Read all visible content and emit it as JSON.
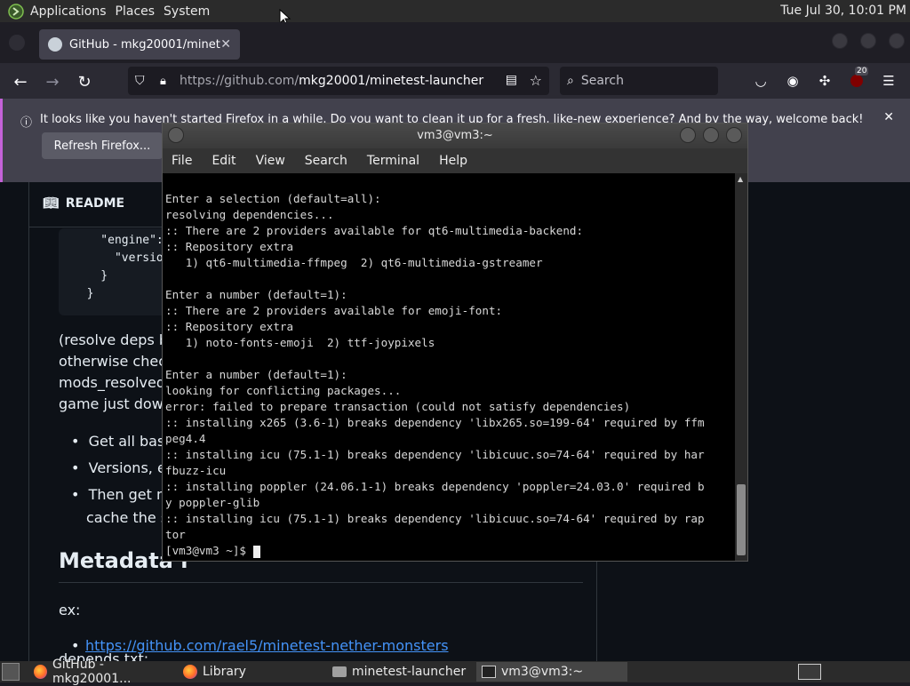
{
  "top_panel": {
    "menus": [
      "Applications",
      "Places",
      "System"
    ],
    "clock": "Tue Jul 30, 10:01 PM"
  },
  "firefox": {
    "tab_title": "GitHub - mkg20001/minete",
    "url_prefix": "https://github.com/",
    "url_path": "mkg20001/minetest-launcher",
    "search_placeholder": "Search",
    "badge_count": "20",
    "notification_text": "It looks like you haven't started Firefox in a while. Do you want to clean it up for a fresh, like-new experience? And by the way, welcome back!",
    "notification_button": "Refresh Firefox..."
  },
  "github": {
    "readme_label": "README",
    "code_lines": [
      "    \"engine\": {",
      "      \"version\"",
      "    }",
      "  }"
    ],
    "para_lines": [
      "(resolve deps by",
      "otherwise check",
      "mods_resolved -",
      "game just downlo"
    ],
    "bullets": [
      "Get all basic",
      "Versions, et",
      "Then get me",
      "cache the so"
    ],
    "metadata_heading": "Metadata r",
    "ex_label": "ex:",
    "link": "https://github.com/rael5/minetest-nether-monsters",
    "depends_label": "depends.txt:"
  },
  "terminal": {
    "title": "vm3@vm3:~",
    "menu": [
      "File",
      "Edit",
      "View",
      "Search",
      "Terminal",
      "Help"
    ],
    "lines": [
      "Enter a selection (default=all):",
      "resolving dependencies...",
      ":: There are 2 providers available for qt6-multimedia-backend:",
      ":: Repository extra",
      "   1) qt6-multimedia-ffmpeg  2) qt6-multimedia-gstreamer",
      "",
      "Enter a number (default=1):",
      ":: There are 2 providers available for emoji-font:",
      ":: Repository extra",
      "   1) noto-fonts-emoji  2) ttf-joypixels",
      "",
      "Enter a number (default=1):",
      "looking for conflicting packages...",
      "error: failed to prepare transaction (could not satisfy dependencies)",
      ":: installing x265 (3.6-1) breaks dependency 'libx265.so=199-64' required by ffm",
      "peg4.4",
      ":: installing icu (75.1-1) breaks dependency 'libicuuc.so=74-64' required by har",
      "fbuzz-icu",
      ":: installing poppler (24.06.1-1) breaks dependency 'poppler=24.03.0' required b",
      "y poppler-glib",
      ":: installing icu (75.1-1) breaks dependency 'libicuuc.so=74-64' required by rap",
      "tor"
    ],
    "prompt": "[vm3@vm3 ~]$ "
  },
  "taskbar": {
    "items": [
      "GitHub - mkg20001...",
      "Library",
      "minetest-launcher",
      "vm3@vm3:~"
    ]
  }
}
